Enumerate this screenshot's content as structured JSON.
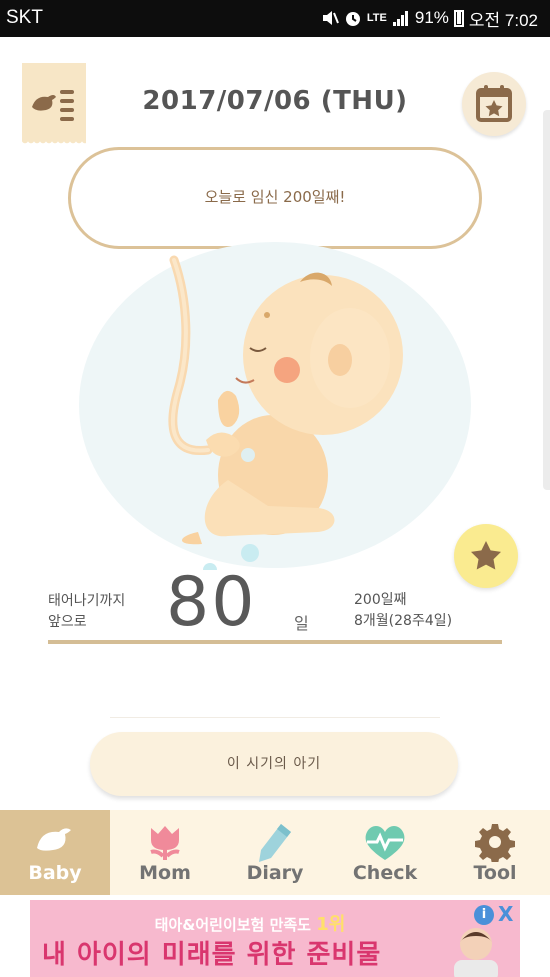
{
  "status_bar": {
    "carrier": "SKT",
    "network": "LTE",
    "battery_percent": "91%",
    "time": "오전 7:02",
    "icons": [
      "mute-icon",
      "alarm-icon",
      "signal-icon",
      "battery-icon"
    ]
  },
  "header": {
    "date": "2017/07/06 (THU)",
    "menu_icon": "menu-list-icon",
    "calendar_icon": "calendar-star-icon"
  },
  "bubble": {
    "message": "오늘로 임신 200일째!"
  },
  "countdown": {
    "label_line1": "태어나기까지",
    "label_line2": "앞으로",
    "days_left": "80",
    "unit": "일",
    "day_count": "200일째",
    "month_week": "8개월(28주4일)"
  },
  "star_button_icon": "star-icon",
  "baby_info_button": "이 시기의 아기",
  "tabs": [
    {
      "label": "Baby",
      "icon": "bird-icon",
      "active": true
    },
    {
      "label": "Mom",
      "icon": "tulip-icon",
      "active": false
    },
    {
      "label": "Diary",
      "icon": "pencil-icon",
      "active": false
    },
    {
      "label": "Check",
      "icon": "heartbeat-icon",
      "active": false
    },
    {
      "label": "Tool",
      "icon": "gear-icon",
      "active": false
    }
  ],
  "ad": {
    "top_text": "태아&어린이보험 만족도",
    "top_highlight": "1위",
    "main_text": "내 아이의 미래를 위한 준비물",
    "info_glyph": "i",
    "close_glyph": "X"
  },
  "colors": {
    "accent": "#dcc295",
    "bubble_border": "#dcc298",
    "tab_bar_bg": "#fdf4e2",
    "star_bg": "#faeb90",
    "ad_bg": "#f7b9ce",
    "ad_text": "#d9366e"
  }
}
